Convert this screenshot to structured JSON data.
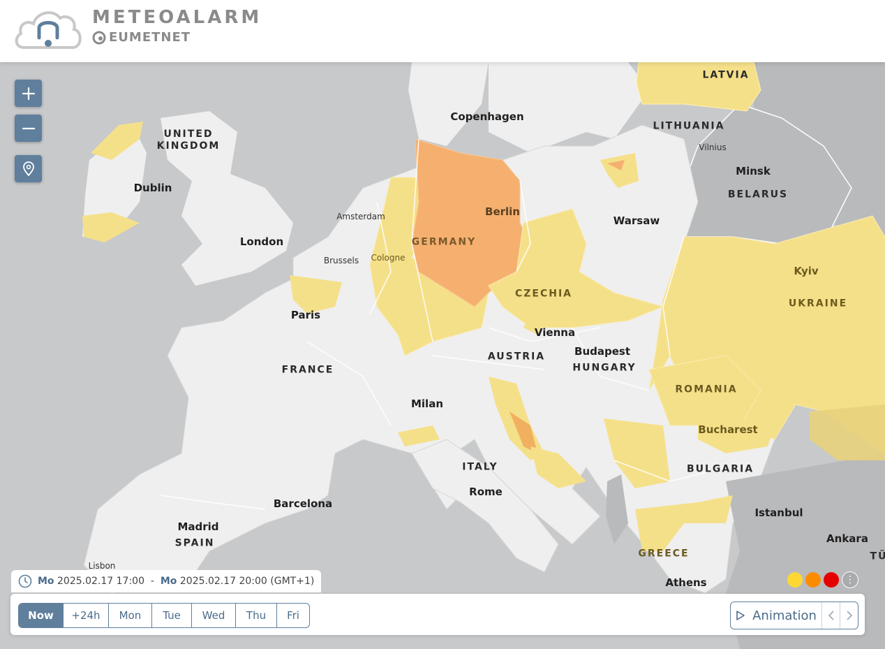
{
  "header": {
    "brand": "METEOALARM",
    "sub_brand": "EUMETNET",
    "logo_icon": "bell-cloud-icon"
  },
  "colors": {
    "land": "#efefef",
    "sea": "#c7c9cb",
    "outside": "#b9babc",
    "yellow": "#f5e08a",
    "orange": "#f5b070",
    "accent": "#5f7f9c",
    "legend_yellow": "#fdd835",
    "legend_orange": "#fb8c00",
    "legend_red": "#e50000"
  },
  "map": {
    "labels": {
      "latvia": "LATVIA",
      "copenhagen": "Copenhagen",
      "lithuania": "LITHUANIA",
      "vilnius": "Vilnius",
      "uk": "UNITED\nKINGDOM",
      "minsk": "Minsk",
      "belarus": "BELARUS",
      "dublin": "Dublin",
      "berlin": "Berlin",
      "amsterdam": "Amsterdam",
      "warsaw": "Warsaw",
      "london": "London",
      "germany": "GERMANY",
      "kyiv": "Kyiv",
      "cologne": "Cologne",
      "brussels": "Brussels",
      "czechia": "CZECHIA",
      "ukraine": "UKRAINE",
      "paris": "Paris",
      "vienna": "Vienna",
      "budapest": "Budapest",
      "austria": "AUSTRIA",
      "hungary": "HUNGARY",
      "france": "FRANCE",
      "romania": "ROMANIA",
      "milan": "Milan",
      "bucharest": "Bucharest",
      "italy": "ITALY",
      "bulgaria": "BULGARIA",
      "rome": "Rome",
      "barcelona": "Barcelona",
      "istanbul": "Istanbul",
      "madrid": "Madrid",
      "ankara": "Ankara",
      "spain": "SPAIN",
      "lisbon": "Lisbon",
      "greece": "GREECE",
      "athens": "Athens",
      "turkey_partial": "TÜ"
    }
  },
  "controls": {
    "zoom_in_icon": "plus-icon",
    "zoom_out_icon": "minus-icon",
    "locate_icon": "location-pin-icon"
  },
  "time_range": {
    "start_day": "Mo",
    "start": "2025.02.17 17:00",
    "separator": "-",
    "end_day": "Mo",
    "end": "2025.02.17 20:00 (GMT+1)"
  },
  "day_tabs": [
    {
      "label": "Now",
      "active": true
    },
    {
      "label": "+24h",
      "active": false
    },
    {
      "label": "Mon",
      "active": false
    },
    {
      "label": "Tue",
      "active": false
    },
    {
      "label": "Wed",
      "active": false
    },
    {
      "label": "Thu",
      "active": false
    },
    {
      "label": "Fri",
      "active": false
    }
  ],
  "animation": {
    "label": "Animation",
    "prev_icon": "chevron-left-icon",
    "next_icon": "chevron-right-icon"
  }
}
